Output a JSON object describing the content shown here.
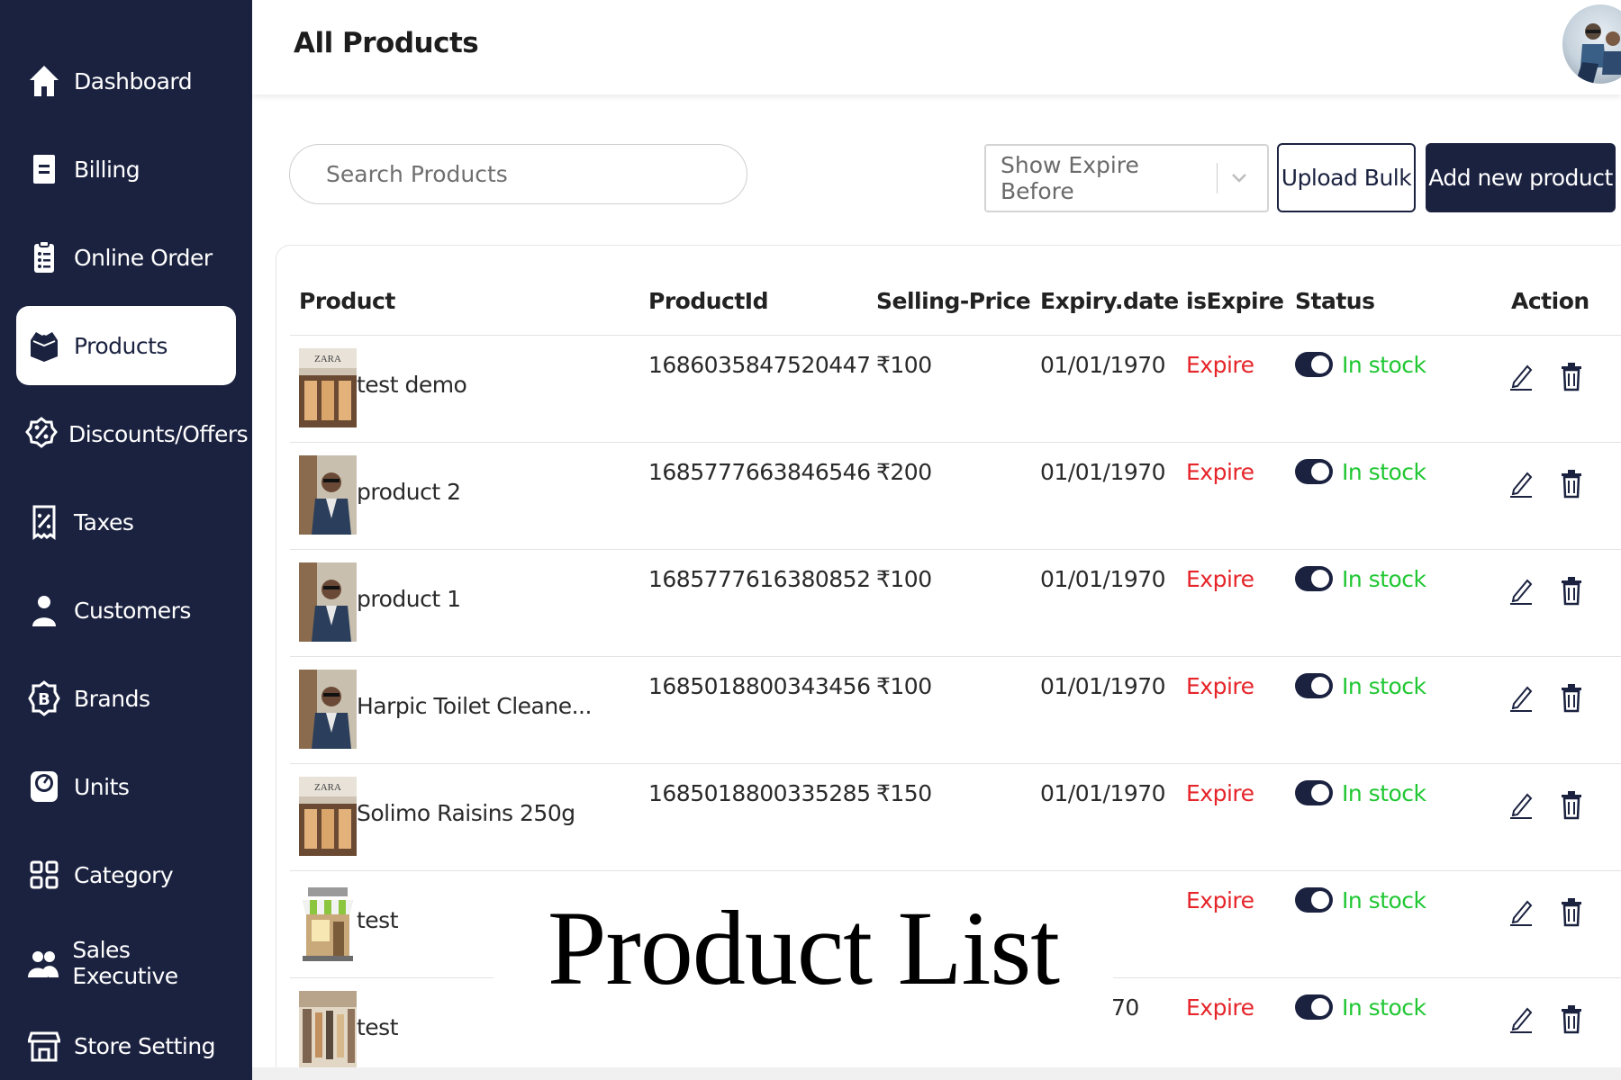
{
  "sidebar": {
    "items": [
      {
        "label": "Dashboard",
        "icon": "home-icon"
      },
      {
        "label": "Billing",
        "icon": "bill-icon"
      },
      {
        "label": "Online Order",
        "icon": "clipboard-list-icon"
      },
      {
        "label": "Products",
        "icon": "box-icon",
        "active": true
      },
      {
        "label": "Discounts/Offers",
        "icon": "percent-badge-icon"
      },
      {
        "label": "Taxes",
        "icon": "receipt-percent-icon"
      },
      {
        "label": "Customers",
        "icon": "user-icon"
      },
      {
        "label": "Brands",
        "icon": "brand-b-icon"
      },
      {
        "label": "Units",
        "icon": "scale-icon"
      },
      {
        "label": "Category",
        "icon": "grid-icon"
      },
      {
        "label": "Sales Executive",
        "icon": "users-icon"
      },
      {
        "label": "Store Setting",
        "icon": "store-icon"
      }
    ]
  },
  "header": {
    "title": "All Products",
    "avatar_icon": "user-avatar-photo"
  },
  "toolbar": {
    "search_placeholder": "Search Products",
    "expire_filter_value": "Show Expire Before",
    "upload_label": "Upload Bulk",
    "add_label": "Add new product"
  },
  "table": {
    "headers": {
      "product": "Product",
      "product_id": "ProductId",
      "selling_price": "Selling-Price",
      "expiry_date": "Expiry.date",
      "is_expire": "isExpire",
      "status": "Status",
      "action": "Action"
    },
    "rows": [
      {
        "name": "test demo",
        "product_id": "1686035847520447",
        "price": "₹100",
        "expiry": "01/01/1970",
        "is_expire": "Expire",
        "status": "In stock",
        "thumb": "store-thumb"
      },
      {
        "name": "product 2",
        "product_id": "1685777663846546",
        "price": "₹200",
        "expiry": "01/01/1970",
        "is_expire": "Expire",
        "status": "In stock",
        "thumb": "person-thumb"
      },
      {
        "name": "product 1",
        "product_id": "1685777616380852",
        "price": "₹100",
        "expiry": "01/01/1970",
        "is_expire": "Expire",
        "status": "In stock",
        "thumb": "person-thumb"
      },
      {
        "name": "Harpic Toilet Cleane...",
        "product_id": "1685018800343456",
        "price": "₹100",
        "expiry": "01/01/1970",
        "is_expire": "Expire",
        "status": "In stock",
        "thumb": "person-thumb"
      },
      {
        "name": "Solimo Raisins 250g",
        "product_id": "1685018800335285",
        "price": "₹150",
        "expiry": "01/01/1970",
        "is_expire": "Expire",
        "status": "In stock",
        "thumb": "store-thumb"
      },
      {
        "name": "test",
        "product_id": "",
        "price": "",
        "expiry": "",
        "is_expire": "Expire",
        "status": "In stock",
        "thumb": "shop-thumb"
      },
      {
        "name": "test",
        "product_id": "",
        "price": "",
        "expiry": "70",
        "is_expire": "Expire",
        "status": "In stock",
        "thumb": "clothes-thumb"
      }
    ],
    "store_sign": "ZARA"
  },
  "overlay": {
    "caption": "Product List"
  },
  "colors": {
    "sidebar_bg": "#1b2240",
    "expire_red": "#e5252a",
    "stock_green": "#20c733"
  }
}
